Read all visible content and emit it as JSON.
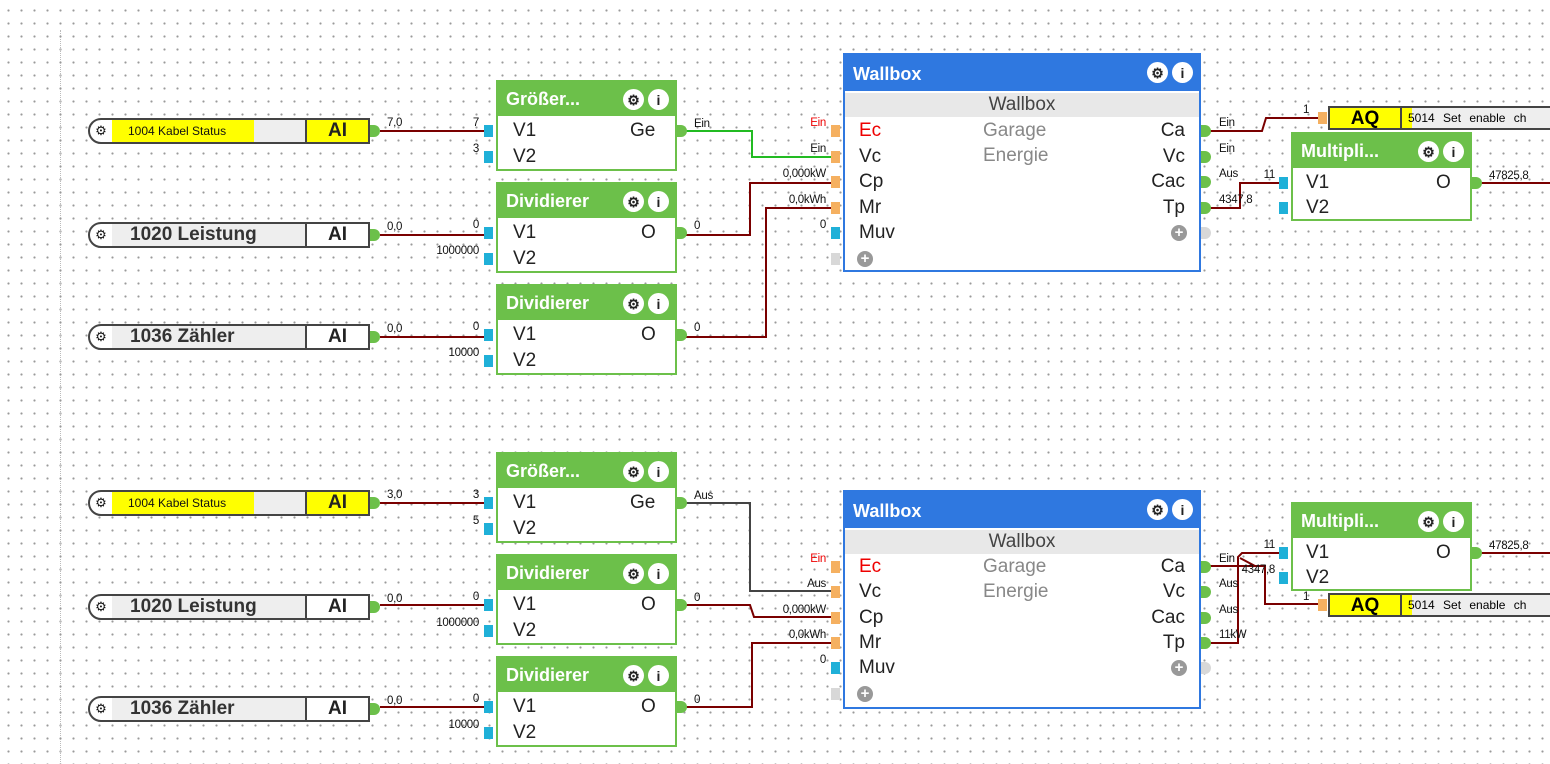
{
  "colors": {
    "function_block": "#6cc04a",
    "wallbox_block": "#2f78e0",
    "wire": "#7a0000",
    "wire_active": "#22bb22",
    "highlight": "#ffff00",
    "input_connector": "#1fb0d8",
    "wallbox_input_connector": "#f5b060"
  },
  "icons": {
    "settings": "gear-icon",
    "info": "info-icon",
    "add": "plus-icon"
  },
  "groups": [
    {
      "inputs": [
        {
          "label": "1004 Kabel Status",
          "type": "AI",
          "value": "7,0",
          "highlighted": true
        },
        {
          "label": "1020 Leistung",
          "type": "AI",
          "value": "0,0",
          "highlighted": false
        },
        {
          "label": "1036 Zähler",
          "type": "AI",
          "value": "0,0",
          "highlighted": false
        }
      ],
      "blocks": [
        {
          "title": "Größer...",
          "inputs": [
            {
              "name": "V1",
              "value": "7"
            },
            {
              "name": "V2",
              "value": "3"
            }
          ],
          "output": {
            "name": "Ge",
            "value": "Ein"
          }
        },
        {
          "title": "Dividierer",
          "inputs": [
            {
              "name": "V1",
              "value": "0"
            },
            {
              "name": "V2",
              "value": "1000000"
            }
          ],
          "output": {
            "name": "O",
            "value": "0"
          }
        },
        {
          "title": "Dividierer",
          "inputs": [
            {
              "name": "V1",
              "value": "0"
            },
            {
              "name": "V2",
              "value": "10000"
            }
          ],
          "output": {
            "name": "O",
            "value": "0"
          }
        }
      ],
      "wallbox": {
        "title": "Wallbox",
        "subtitle": "Wallbox",
        "room": "Garage",
        "category": "Energie",
        "inputs": [
          {
            "name": "Ec",
            "value": "Ein"
          },
          {
            "name": "Vc",
            "value": "Ein"
          },
          {
            "name": "Cp",
            "value": "0,000kW"
          },
          {
            "name": "Mr",
            "value": "0,0kWh"
          },
          {
            "name": "Muv",
            "value": "0"
          }
        ],
        "outputs": [
          {
            "name": "Ca",
            "value": "Ein"
          },
          {
            "name": "Vc",
            "value": "Ein"
          },
          {
            "name": "Cac",
            "value": "Aus"
          },
          {
            "name": "Tp",
            "value": "4347,8"
          }
        ]
      },
      "multiplier": {
        "title": "Multipli...",
        "inputs": [
          {
            "name": "V1",
            "value": "11"
          },
          {
            "name": "V2",
            "value": ""
          }
        ],
        "output": {
          "name": "O",
          "value": "47825,8"
        }
      },
      "output": {
        "type": "AQ",
        "label": "5014 Set enable ch",
        "value": "1"
      }
    },
    {
      "inputs": [
        {
          "label": "1004 Kabel Status",
          "type": "AI",
          "value": "3,0",
          "highlighted": true
        },
        {
          "label": "1020 Leistung",
          "type": "AI",
          "value": "0,0",
          "highlighted": false
        },
        {
          "label": "1036 Zähler",
          "type": "AI",
          "value": "0,0",
          "highlighted": false
        }
      ],
      "blocks": [
        {
          "title": "Größer...",
          "inputs": [
            {
              "name": "V1",
              "value": "3"
            },
            {
              "name": "V2",
              "value": "5"
            }
          ],
          "output": {
            "name": "Ge",
            "value": "Aus"
          }
        },
        {
          "title": "Dividierer",
          "inputs": [
            {
              "name": "V1",
              "value": "0"
            },
            {
              "name": "V2",
              "value": "1000000"
            }
          ],
          "output": {
            "name": "O",
            "value": "0"
          }
        },
        {
          "title": "Dividierer",
          "inputs": [
            {
              "name": "V1",
              "value": "0"
            },
            {
              "name": "V2",
              "value": "10000"
            }
          ],
          "output": {
            "name": "O",
            "value": "0"
          }
        }
      ],
      "wallbox": {
        "title": "Wallbox",
        "subtitle": "Wallbox",
        "room": "Garage",
        "category": "Energie",
        "inputs": [
          {
            "name": "Ec",
            "value": "Ein"
          },
          {
            "name": "Vc",
            "value": "Aus"
          },
          {
            "name": "Cp",
            "value": "0,000kW"
          },
          {
            "name": "Mr",
            "value": "0,0kWh"
          },
          {
            "name": "Muv",
            "value": "0"
          }
        ],
        "outputs": [
          {
            "name": "Ca",
            "value": "Ein"
          },
          {
            "name": "Vc",
            "value": "Aus"
          },
          {
            "name": "Cac",
            "value": "Aus"
          },
          {
            "name": "Tp",
            "value": "11kW"
          }
        ]
      },
      "multiplier": {
        "title": "Multipli...",
        "inputs": [
          {
            "name": "V1",
            "value": "11"
          },
          {
            "name": "V2",
            "value": "4347,8"
          }
        ],
        "output": {
          "name": "O",
          "value": "47825,8"
        }
      },
      "output": {
        "type": "AQ",
        "label": "5014 Set enable ch",
        "value": "1"
      }
    }
  ]
}
